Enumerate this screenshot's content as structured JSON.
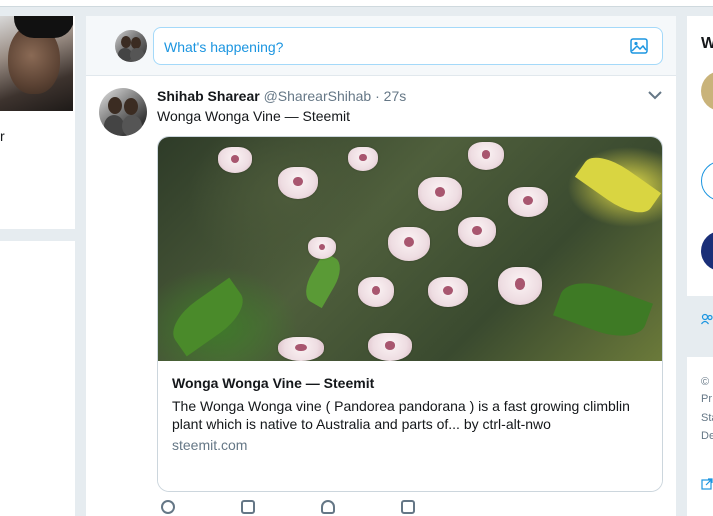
{
  "left": {
    "name_fragment": "r"
  },
  "composer": {
    "placeholder": "What's happening?"
  },
  "tweet": {
    "name": "Shihab Sharear",
    "handle": "@SharearShihab",
    "separator": "·",
    "time": "27s",
    "text": "Wonga Wonga Vine — Steemit",
    "card": {
      "title": "Wonga Wonga Vine — Steemit",
      "description": "The Wonga Wonga vine ( Pandorea pandorana ) is a fast growing climblin plant which is native to Australia and parts of... by ctrl-alt-nwo",
      "domain": "steemit.com"
    }
  },
  "right": {
    "title_fragment": "W",
    "footer_lines": [
      "©",
      "Pr",
      "Sta",
      "De"
    ]
  },
  "colors": {
    "accent": "#1b95e0",
    "background": "#e6ecf0",
    "secondary_text": "#657786"
  },
  "icons": [
    "image-icon",
    "chevron-down-icon",
    "reply-icon",
    "retweet-icon",
    "like-icon",
    "message-icon",
    "people-icon",
    "external-link-icon"
  ]
}
